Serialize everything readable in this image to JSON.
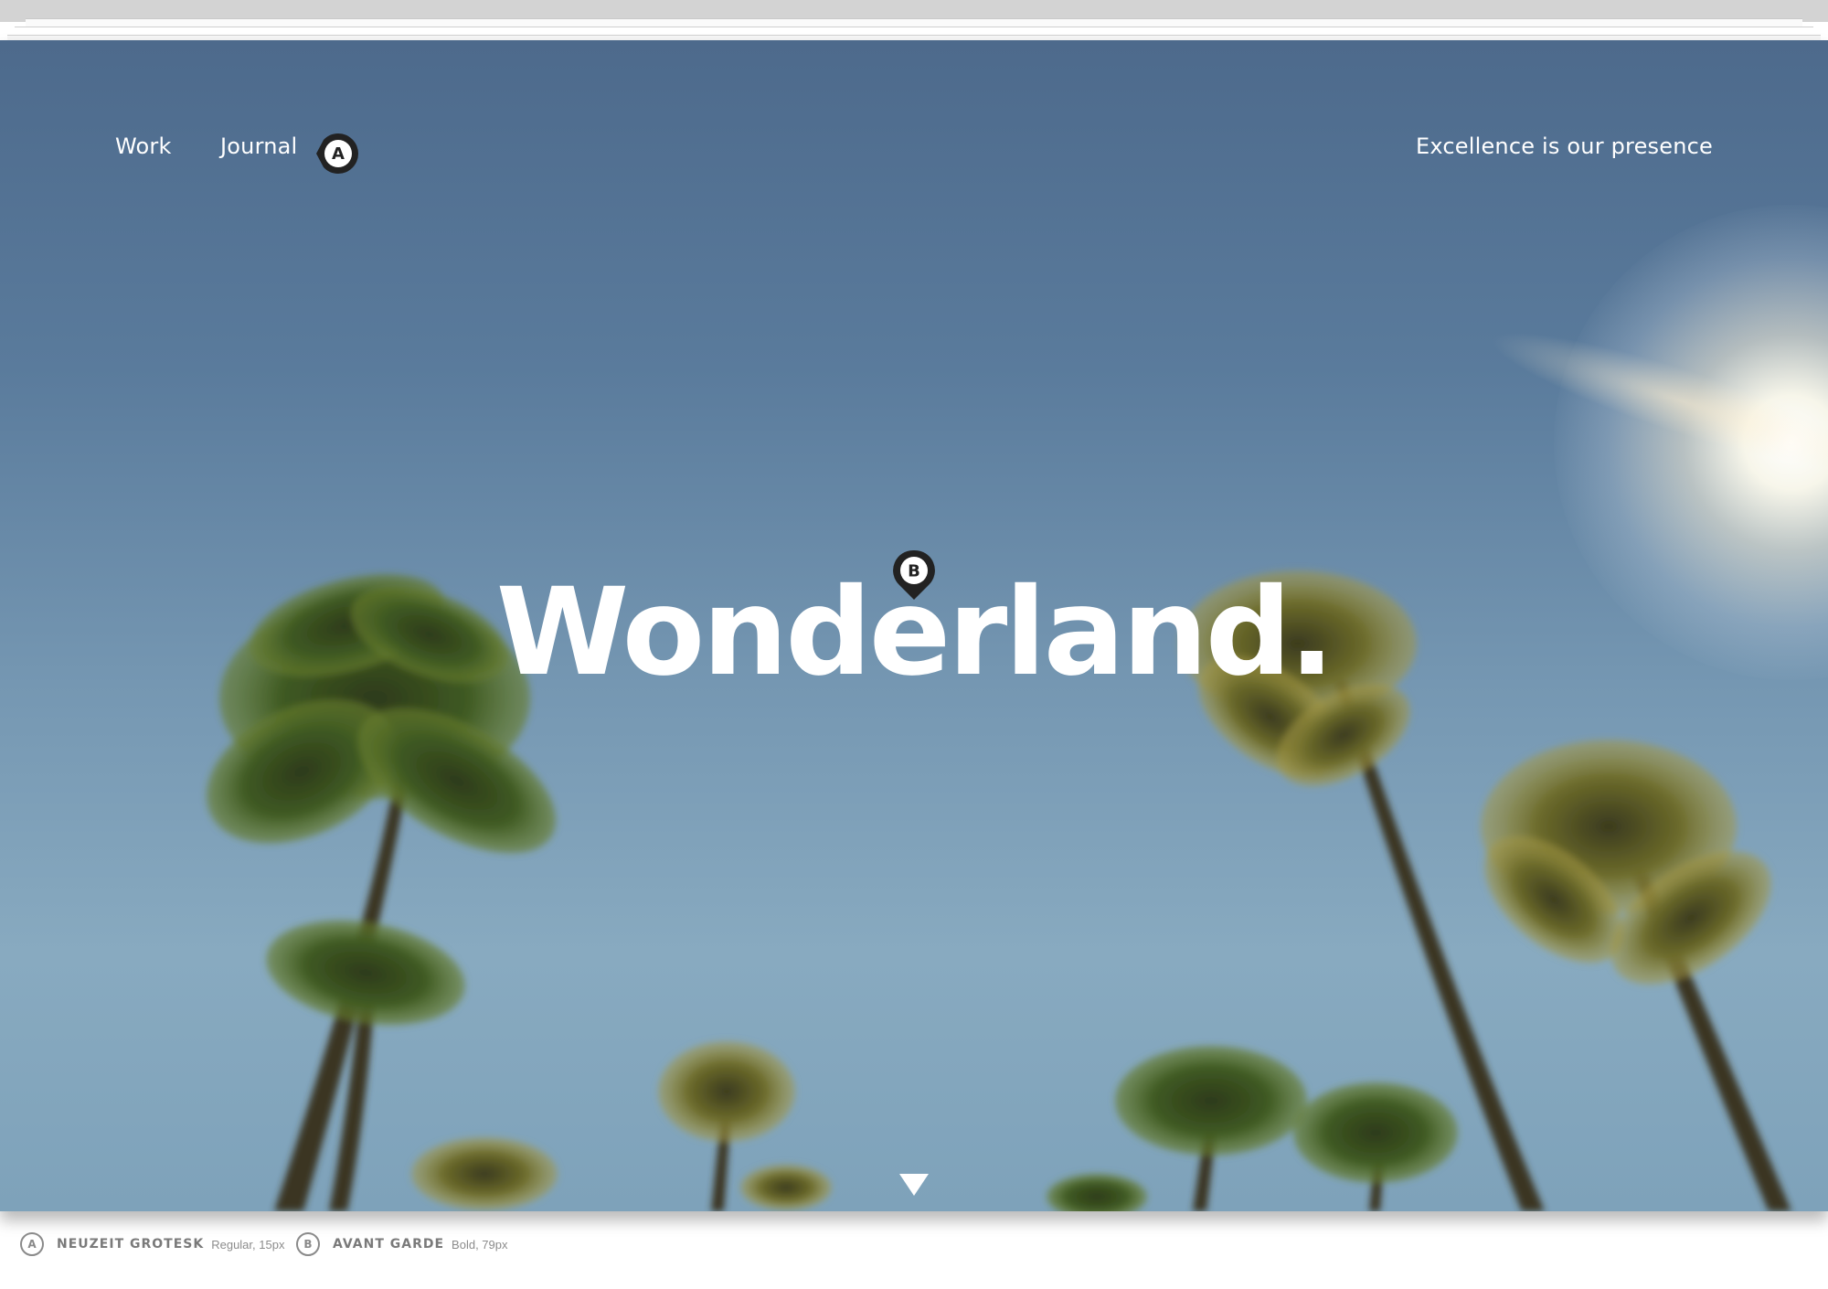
{
  "nav": {
    "work_label": "Work",
    "journal_label": "Journal",
    "tagline": "Excellence is our presence"
  },
  "hero": {
    "title": "Wonderland."
  },
  "markers": {
    "a_letter": "A",
    "b_letter": "B"
  },
  "captions": [
    {
      "letter": "A",
      "font": "NEUZEIT GROTESK",
      "spec": "Regular, 15px"
    },
    {
      "letter": "B",
      "font": "AVANT GARDE",
      "spec": "Bold, 79px"
    }
  ],
  "icons": {
    "scroll": "triangle-down-icon",
    "marker": "map-pin-icon"
  },
  "colors": {
    "sky_top": "#4d6a8c",
    "sky_bottom": "#88aac0",
    "text": "#ffffff",
    "marker": "#222222",
    "caption": "#7a7a7a"
  }
}
